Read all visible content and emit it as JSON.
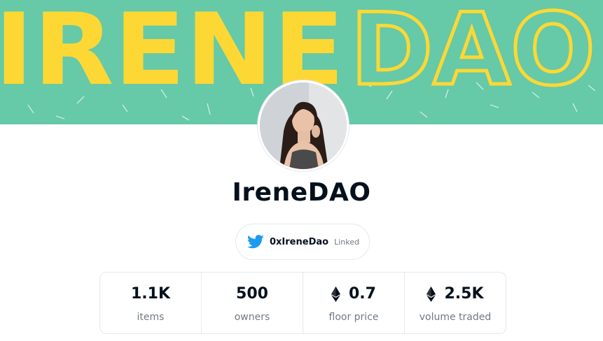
{
  "banner": {
    "text_solid": "IRENE",
    "text_outline": "DAO",
    "background_color": "#66c9a7",
    "text_color": "#fdd835"
  },
  "collection": {
    "name": "IreneDAO"
  },
  "social": {
    "icon": "twitter-icon",
    "handle": "0xIreneDao",
    "status": "Linked",
    "icon_color": "#1d9bf0"
  },
  "stats": [
    {
      "value": "1.1K",
      "label": "items",
      "eth": false
    },
    {
      "value": "500",
      "label": "owners",
      "eth": false
    },
    {
      "value": "0.7",
      "label": "floor price",
      "eth": true
    },
    {
      "value": "2.5K",
      "label": "volume traded",
      "eth": true
    }
  ]
}
